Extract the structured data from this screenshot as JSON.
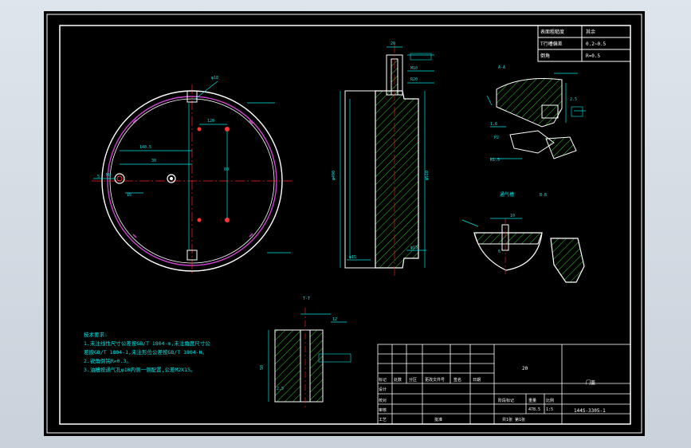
{
  "colors": {
    "background": "#000000",
    "outline": "#ffffff",
    "dimension": "#00e5e5",
    "centerline": "#ff2020",
    "hatch": "#33cc33",
    "magenta": "#cc44cc",
    "ring": "#ff3333"
  },
  "title_block": {
    "weight": "20",
    "part_name": "门盖",
    "drawing_no": "144S-3305-1",
    "row_labels": [
      "标记",
      "处数",
      "分区",
      "更改文件号",
      "签名",
      "日期"
    ],
    "design": "设计",
    "check": "校对",
    "review": "审核",
    "process": "工艺",
    "approve": "批准",
    "stage_mark": "阶段标记",
    "weight_label": "重量",
    "scale_label": "比例",
    "scale": "1:5",
    "weight_val": "478.5",
    "sheets": "共1张  第1张"
  },
  "spec_table": {
    "rows": [
      [
        "表面粗糙度",
        "其余"
      ],
      [
        "T行槽偏差",
        "0.2~0.5"
      ],
      [
        "倒角",
        "R=0.5"
      ]
    ]
  },
  "notes": {
    "title": "技术要求:",
    "lines": [
      "1.未注线性尺寸公差按GB/T 1804-m,未注角度尺寸公",
      "差按GB/T 1804-1,未注形位公差按GB/T 1804-H。",
      "2.锐角倒钝R=0.3。",
      "3.油槽按通气孔φ10内侧一侧配置,公差M2X15。"
    ]
  },
  "views": {
    "section_aa": "A-A",
    "section_bb": "B-B",
    "section_tt": "T-T",
    "vent_groove": "通气槽",
    "dims": [
      "120",
      "30",
      "140.5",
      "M8",
      "φ18",
      "15",
      "5",
      "80",
      "φ490",
      "φ510",
      "φ15",
      "20",
      "R20",
      "M10",
      "2.5",
      "1.6",
      "10",
      "6",
      "50",
      "12",
      "2.5",
      "P2",
      "R1.5"
    ]
  }
}
